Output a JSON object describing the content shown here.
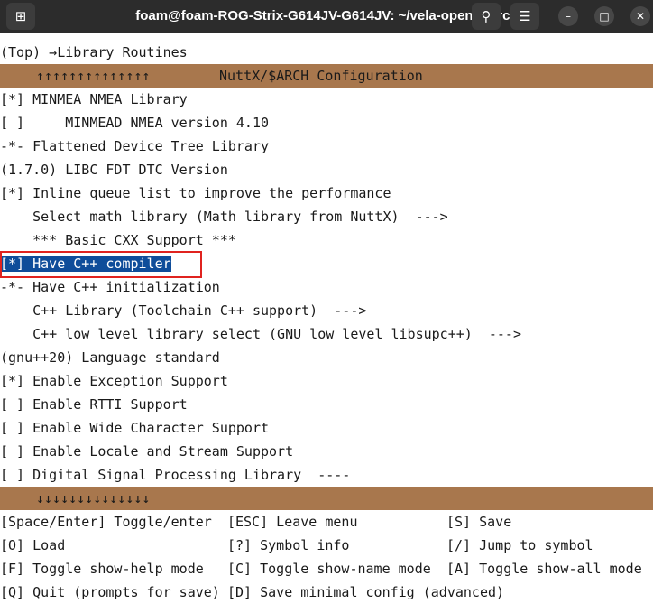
{
  "window": {
    "title": "foam@foam-ROG-Strix-G614JV-G614JV: ~/vela-opensource",
    "new_tab_icon": "new-tab-icon",
    "search_icon": "search-icon",
    "menu_icon": "hamburger-menu-icon",
    "minimize_icon": "minimize-icon",
    "maximize_icon": "maximize-icon",
    "close_icon": "close-icon"
  },
  "terminal": {
    "breadcrumb": "(Top) →Library Routines",
    "header": {
      "arrows": "↑↑↑↑↑↑↑↑↑↑↑↑↑↑",
      "title": "NuttX/$ARCH Configuration"
    },
    "items": [
      "[*] MINMEA NMEA Library",
      "[ ]     MINMEAD NMEA version 4.10",
      "-*- Flattened Device Tree Library",
      "(1.7.0) LIBC FDT DTC Version",
      "[*] Inline queue list to improve the performance",
      "    Select math library (Math library from NuttX)  --->",
      "    *** Basic CXX Support ***",
      "[*] Have C++ compiler",
      "-*- Have C++ initialization",
      "    C++ Library (Toolchain C++ support)  --->",
      "    C++ low level library select (GNU low level libsupc++)  --->",
      "(gnu++20) Language standard",
      "[*] Enable Exception Support",
      "[ ] Enable RTTI Support",
      "[ ] Enable Wide Character Support",
      "[ ] Enable Locale and Stream Support",
      "[ ] Digital Signal Processing Library  ----"
    ],
    "selected_index": 7,
    "footer": {
      "arrows": "↓↓↓↓↓↓↓↓↓↓↓↓↓↓"
    },
    "help": [
      [
        "[Space/Enter] Toggle/enter",
        "[ESC] Leave menu",
        "[S] Save"
      ],
      [
        "[O] Load",
        "[?] Symbol info",
        "[/] Jump to symbol"
      ],
      [
        "[F] Toggle show-help mode",
        "[C] Toggle show-name mode",
        "[A] Toggle show-all mode"
      ],
      [
        "[Q] Quit (prompts for save)",
        "[D] Save minimal config (advanced)",
        ""
      ]
    ]
  },
  "colors": {
    "titlebar": "#2c2c2c",
    "header_bar": "#a8774d",
    "selection": "#0f4d9a",
    "annotation_box": "#e0231f"
  }
}
